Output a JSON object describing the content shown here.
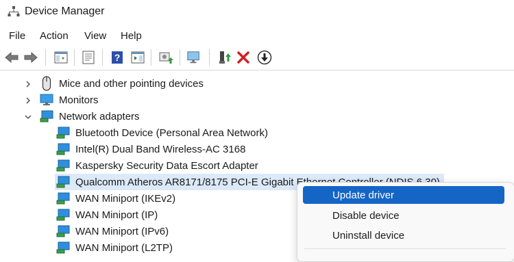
{
  "window": {
    "title": "Device Manager"
  },
  "menu": [
    "File",
    "Action",
    "View",
    "Help"
  ],
  "toolbar": {
    "buttons": [
      "back-icon",
      "forward-icon",
      "show-hide-console-tree-icon",
      "properties-icon",
      "help-icon",
      "show-action-pane-icon",
      "update-driver-icon",
      "scan-hardware-changes-icon",
      "enable-device-icon",
      "uninstall-device-icon",
      "disable-device-icon"
    ]
  },
  "tree": {
    "categories": [
      {
        "label": "Mice and other pointing devices",
        "expanded": false
      },
      {
        "label": "Monitors",
        "expanded": false
      },
      {
        "label": "Network adapters",
        "expanded": true
      }
    ],
    "devices": [
      "Bluetooth Device (Personal Area Network)",
      "Intel(R) Dual Band Wireless-AC 3168",
      "Kaspersky Security Data Escort Adapter",
      "Qualcomm Atheros AR8171/8175 PCI-E Gigabit Ethernet Controller (NDIS 6.30)",
      "WAN Miniport (IKEv2)",
      "WAN Miniport (IP)",
      "WAN Miniport (IPv6)",
      "WAN Miniport (L2TP)"
    ],
    "selected_device_index": 3
  },
  "context_menu": {
    "items": [
      "Update driver",
      "Disable device",
      "Uninstall device"
    ],
    "highlighted_index": 0
  },
  "colors": {
    "selection": "#dbe9f8",
    "menu_highlight": "#1565c6",
    "network_icon": "#2f8fdc",
    "monitor_icon": "#3a9fe8"
  }
}
